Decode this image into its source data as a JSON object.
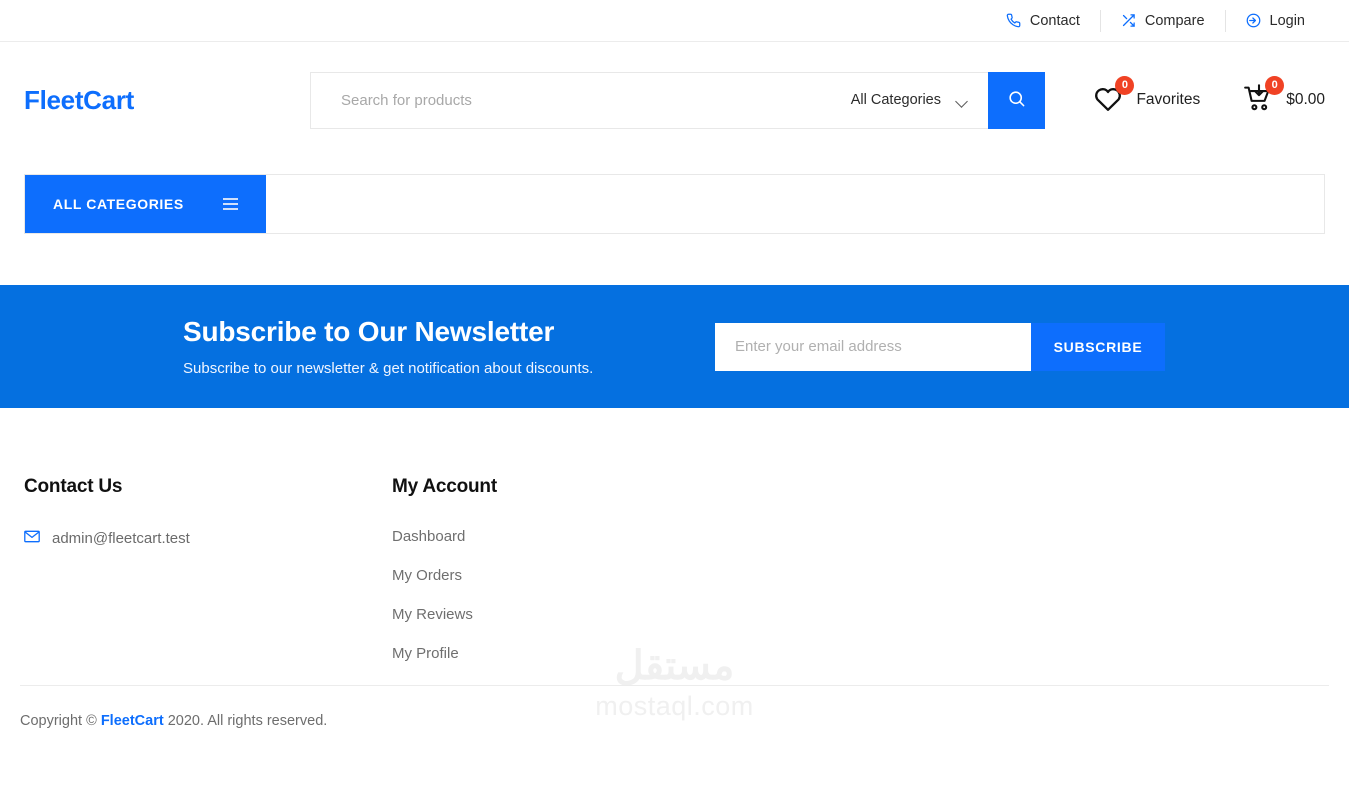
{
  "topbar": {
    "items": [
      {
        "label": "Contact",
        "icon": "phone-icon"
      },
      {
        "label": "Compare",
        "icon": "shuffle-icon"
      },
      {
        "label": "Login",
        "icon": "sign-in-icon"
      }
    ]
  },
  "header": {
    "logo": "FleetCart",
    "search": {
      "placeholder": "Search for products",
      "value": "",
      "category_selected": "All Categories",
      "button_icon": "search-icon"
    },
    "favorites": {
      "label": "Favorites",
      "count": "0",
      "icon": "heart-icon"
    },
    "cart": {
      "amount": "$0.00",
      "count": "0",
      "icon": "cart-icon"
    }
  },
  "catnav": {
    "all_categories_label": "ALL CATEGORIES",
    "menu_icon": "hamburger-icon"
  },
  "newsletter": {
    "title": "Subscribe to Our Newsletter",
    "subtitle": "Subscribe to our newsletter & get notification about discounts.",
    "email_placeholder": "Enter your email address",
    "email_value": "",
    "button_label": "SUBSCRIBE"
  },
  "footer": {
    "contact": {
      "title": "Contact Us",
      "email": "admin@fleetcart.test",
      "email_icon": "mail-icon"
    },
    "account": {
      "title": "My Account",
      "links": [
        "Dashboard",
        "My Orders",
        "My Reviews",
        "My Profile"
      ]
    },
    "copyright": {
      "prefix": "Copyright © ",
      "brand": "FleetCart",
      "suffix": " 2020. All rights reserved."
    },
    "watermark": {
      "arabic": "مستقل",
      "latin": "mostaql.com"
    }
  },
  "colors": {
    "accent": "#0d6efd",
    "banner": "#0570e0",
    "badge": "#f04224"
  }
}
